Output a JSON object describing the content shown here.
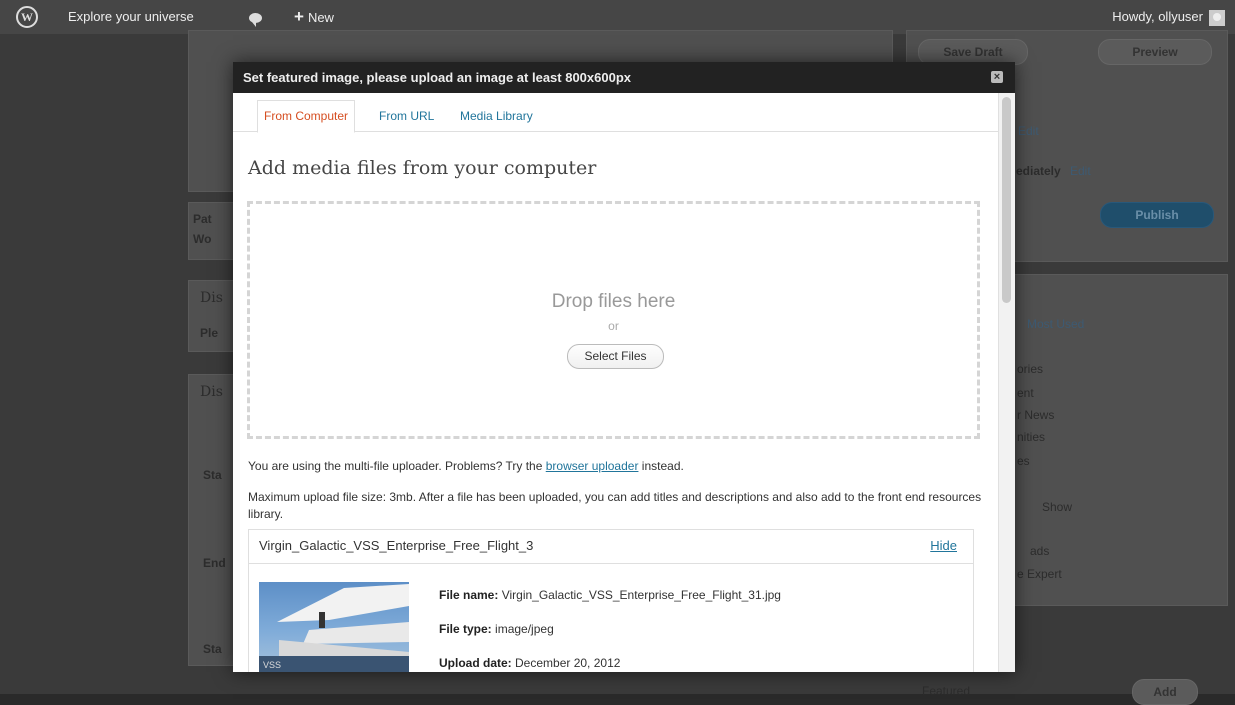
{
  "admin_bar": {
    "site_name": "Explore your universe",
    "new_label": "New",
    "greeting": "Howdy, ollyuser"
  },
  "background_page": {
    "save_draft": "Save Draft",
    "preview": "Preview",
    "edit_1": "Edit",
    "publish_immediately": "ediately",
    "edit_2": "Edit",
    "publish": "Publish",
    "most_used": "Most Used",
    "category_fragments": [
      "ories",
      "ent",
      "r News",
      "nities",
      "es",
      "Show",
      "ads",
      "e Expert"
    ],
    "left_fragments": [
      "Pat",
      "Wo",
      "Dis",
      "Ple",
      "Dis",
      "Sta",
      "End",
      "Sta"
    ],
    "featured": "Featured",
    "add": "Add"
  },
  "modal": {
    "title": "Set featured image, please upload an image at least 800x600px",
    "close_glyph": "×",
    "tabs": [
      {
        "label": "From Computer",
        "active": true
      },
      {
        "label": "From URL",
        "active": false
      },
      {
        "label": "Media Library",
        "active": false
      }
    ],
    "heading": "Add media files from your computer",
    "drop_text": "Drop files here",
    "drop_or": "or",
    "select_files": "Select Files",
    "uploader_notice_prefix": "You are using the multi-file uploader. Problems? Try the",
    "uploader_notice_link": "browser uploader",
    "uploader_notice_suffix": "instead.",
    "max_size_notice": "Maximum upload file size: 3mb. After a file has been uploaded, you can add titles and descriptions and also add to the front end resources library.",
    "file": {
      "title": "Virgin_Galactic_VSS_Enterprise_Free_Flight_3",
      "hide": "Hide",
      "file_name_label": "File name:",
      "file_name": "Virgin_Galactic_VSS_Enterprise_Free_Flight_31.jpg",
      "file_type_label": "File type:",
      "file_type": "image/jpeg",
      "upload_date_label": "Upload date:",
      "upload_date": "December 20, 2012"
    }
  },
  "colors": {
    "admin_bar": "#464646",
    "active_tab": "#d54e21",
    "link": "#21759b",
    "modal_header": "#222222"
  }
}
